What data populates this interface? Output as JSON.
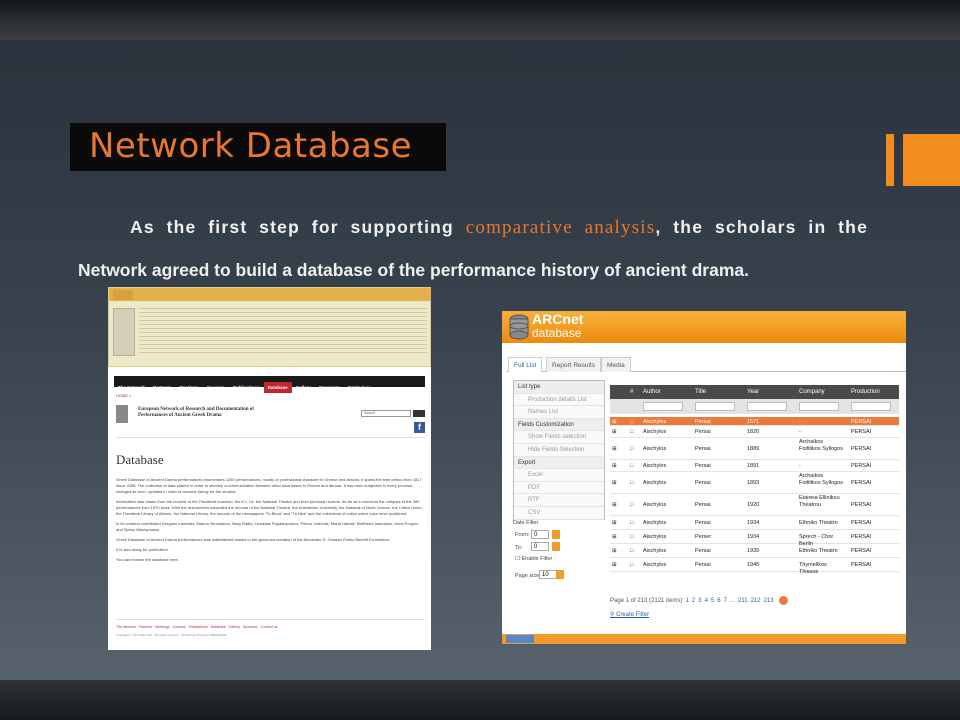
{
  "slide": {
    "title": "Network Database",
    "line1_before": "As the first step for supporting ",
    "line1_highlight": "comparative analysis",
    "line1_after": ", the scholars in the",
    "line2": "Network agreed to build a database of the performance history of ancient drama."
  },
  "left_shot": {
    "menu": [
      "The Network",
      "Partners",
      "Meetings",
      "Courses",
      "Publications",
      "Database",
      "Gallery",
      "Sponsors",
      "Contact us"
    ],
    "active_menu": "Database",
    "home": "HOME »",
    "org_name": "European Network of Research and Documentation of Performances of Ancient Greek Drama",
    "search_placeholder": "Search",
    "heading": "Database",
    "paragraphs": [
      "Greek Database of Ancient Drama performances enumerates 1250 performances, mostly of professional character in Greece and abroad. It spans the time period from 1817 since 2008. The collection of data started in order to develop a communication between other data bases in Greece and abroad. It has been subjected in every process, changed its form, updated in order to become handy for the student.",
      "Information was drawn from the records of the Theatrical museum, the E.L.I.A. the National Theatre and from personal records. As far as it concerns the critiques of the 380 performances from 1970 since 1994 the researchers consulted the records of the National Theatre, the Aristotelian University, the National of North Greece, the Critics Union, the Theatrical Library of Athens, the National Library, the records of the newspapers \"To Bima\" and \"Ta Nea\" and the collections of critics which have been published.",
      "In its creation contributed Gregoris Ioannidis, Marina Yerouianou, Mary Radis, Leonidas Papastopoulos, Petros Vrahiotis, Maria Hamali, Eleftheria Ioannidou, Anna Poupou and Spiros Nikolopoulos.",
      "Greek Database of Ancient Drama performances was materialized thanks to the generous donation of the Alexander S. Onassis Public Benefit Foundation.",
      "It is also ready for publication.",
      "You can browse the database here."
    ],
    "footer_links": "The Network · Partners · Meetings · Courses · Publications · Database · Gallery · Sponsors · Contact us",
    "copyright": "Copyright © 2012 ARC Net · All rights reserved · WordPress Theme by BIRDSOAR"
  },
  "right_shot": {
    "brand_name": "ARCnet",
    "brand_sub": "database",
    "tabs": [
      "Full List",
      "Report Results",
      "Media"
    ],
    "sidebar": [
      {
        "label": "List type",
        "kind": "sec"
      },
      {
        "label": "Production details List",
        "kind": "sub"
      },
      {
        "label": "Names List",
        "kind": "sub"
      },
      {
        "label": "Fields Customization",
        "kind": "sec"
      },
      {
        "label": "Show Fields selection",
        "kind": "sub"
      },
      {
        "label": "Hide Fields Selection",
        "kind": "sub"
      },
      {
        "label": "Export",
        "kind": "sec"
      },
      {
        "label": "Excel",
        "kind": "sub"
      },
      {
        "label": "PDF",
        "kind": "sub"
      },
      {
        "label": "RTF",
        "kind": "sub"
      },
      {
        "label": "CSV",
        "kind": "sub"
      }
    ],
    "date_filter": "Date Filter",
    "from_label": "From:",
    "from_value": "0",
    "to_label": "To:",
    "to_value": "0",
    "enable_filter": "Enable Filter",
    "page_size_label": "Page size",
    "page_size_value": "10",
    "columns": [
      "#",
      "Author",
      "Title",
      "Year",
      "Company",
      "Production"
    ],
    "rows": [
      {
        "author": "Aischylos",
        "title": "Persai",
        "year": "1571",
        "company": "-",
        "production": "PERSAI",
        "selected": true
      },
      {
        "author": "Aischylos",
        "title": "Persai",
        "year": "1820",
        "company": "-",
        "production": "PERSAI"
      },
      {
        "author": "Aischylos",
        "title": "Persai",
        "year": "1889",
        "company": "Archaikos Foititikos Syllogos",
        "production": "PERSAI"
      },
      {
        "author": "Aischylos",
        "title": "Persai",
        "year": "1891",
        "company": "-",
        "production": "PERSAI"
      },
      {
        "author": "Aischylos",
        "title": "Persai",
        "year": "1893",
        "company": "Archaikos Foititikos Syllogos",
        "production": "PERSAI"
      },
      {
        "author": "Aischylos",
        "title": "Persai",
        "year": "1920",
        "company": "Etaireia Ellinikou Theatrou",
        "production": "PERSAI"
      },
      {
        "author": "Aischylos",
        "title": "Persai",
        "year": "1934",
        "company": "Ethniko Theatro",
        "production": "PERSAI"
      },
      {
        "author": "Aischylos",
        "title": "Perser",
        "year": "1934",
        "company": "Sprech - Chor Berlin",
        "production": "PERSAI"
      },
      {
        "author": "Aischylos",
        "title": "Persai",
        "year": "1939",
        "company": "Ethniko Theatro",
        "production": "PERSAI"
      },
      {
        "author": "Aischylos",
        "title": "Persai",
        "year": "1945",
        "company": "Thymelikos Thiasos",
        "production": "PERSAI"
      }
    ],
    "pager_text": "Page 1 of 213 (2121 items)",
    "pages": [
      "1",
      "2",
      "3",
      "4",
      "5",
      "6",
      "7",
      "...",
      "211",
      "212",
      "213"
    ],
    "create_filter": "Create Filter"
  }
}
